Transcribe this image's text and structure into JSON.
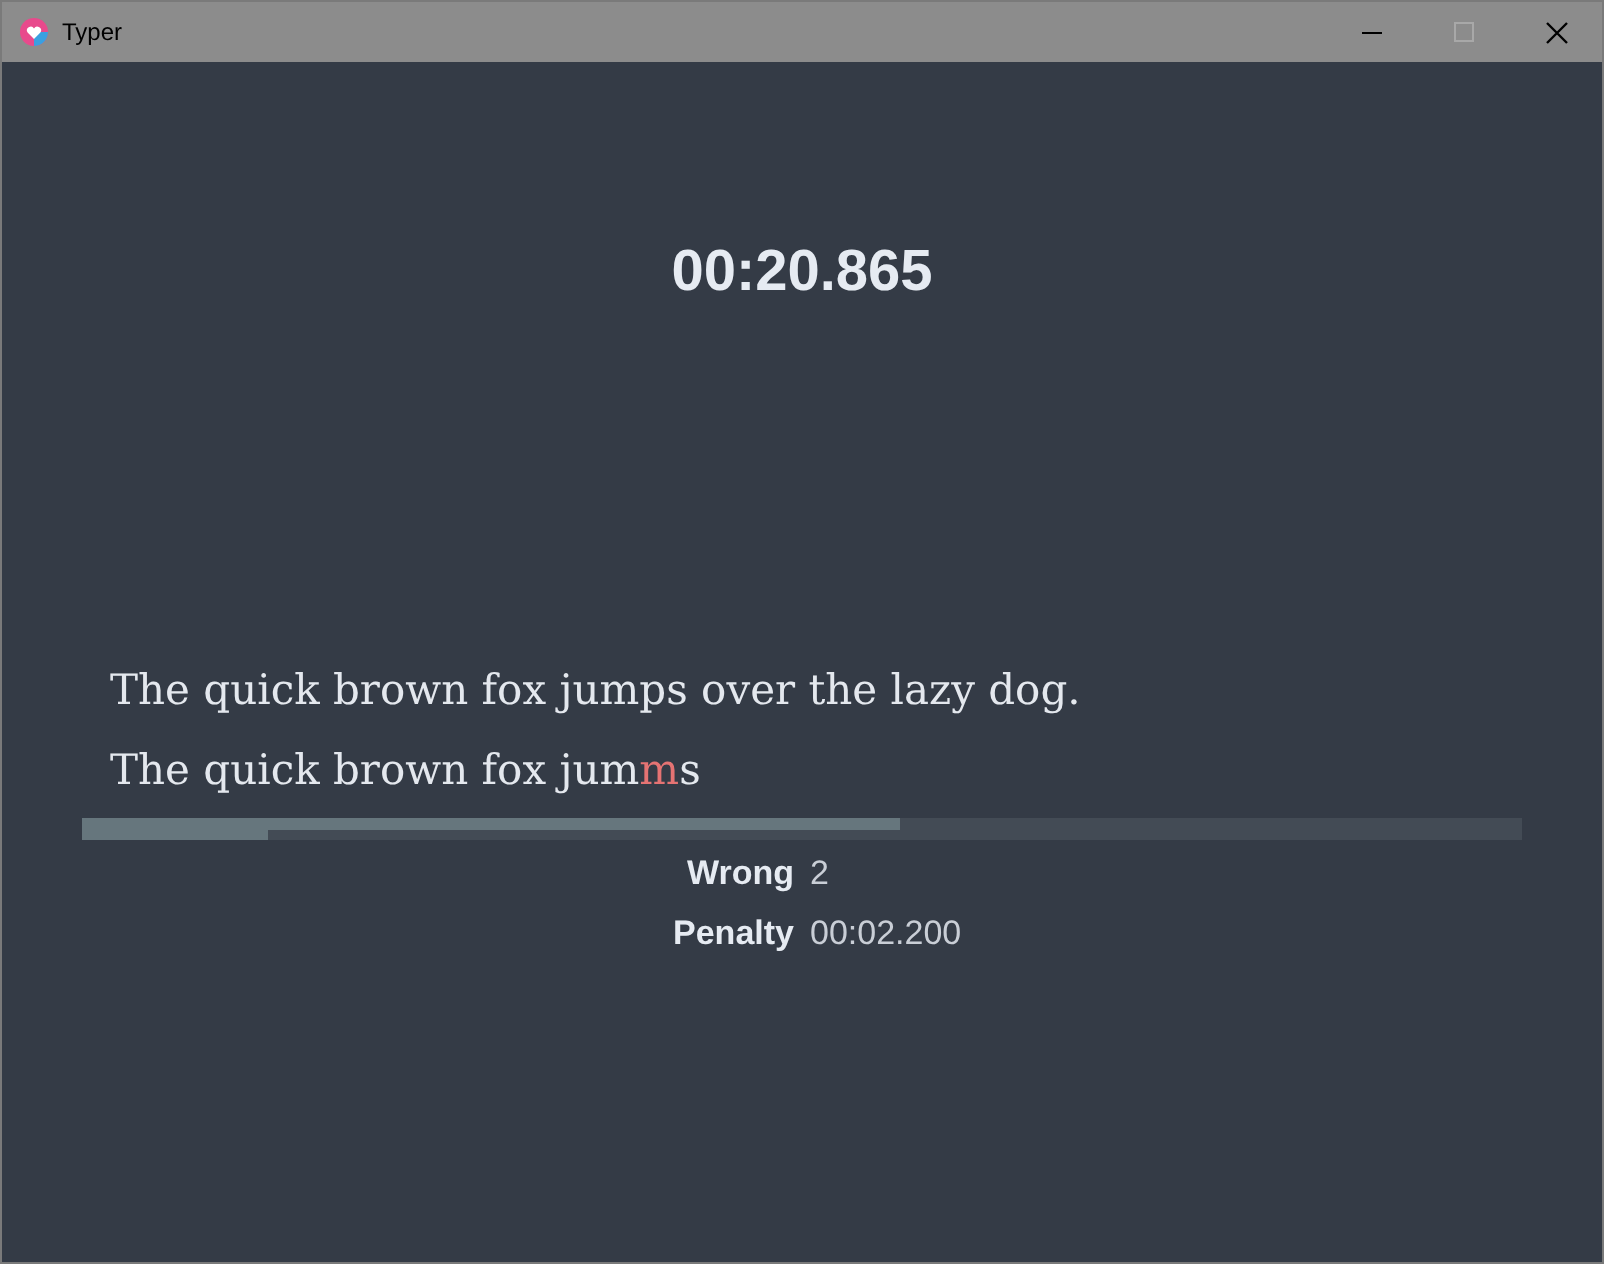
{
  "window": {
    "title": "Typer"
  },
  "timer": "00:20.865",
  "target_text": "The quick brown fox jumps over the lazy dog.",
  "typed": [
    {
      "text": "The quick brown fox jum",
      "wrong": false
    },
    {
      "text": "m",
      "wrong": true
    },
    {
      "text": "s",
      "wrong": false
    }
  ],
  "progress": {
    "typed": {
      "level": 0.568
    },
    "correct": {
      "level": 0.129
    }
  },
  "stats": [
    {
      "label": "Wrong",
      "value": "2"
    },
    {
      "label": "Penalty",
      "value": "00:02.200"
    }
  ]
}
